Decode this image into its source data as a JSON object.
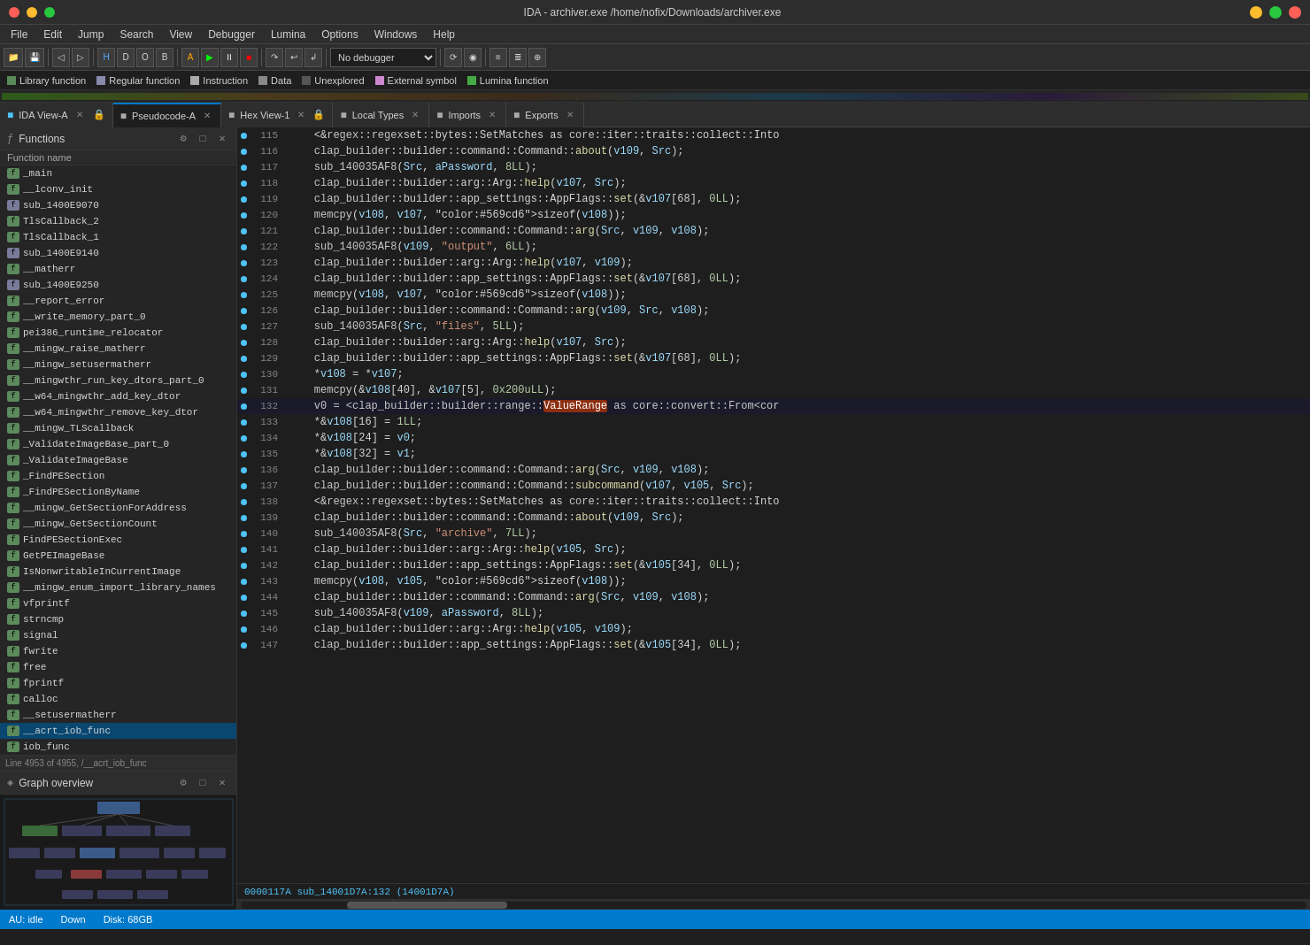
{
  "titlebar": {
    "title": "IDA - archiver.exe /home/nofix/Downloads/archiver.exe"
  },
  "menubar": {
    "items": [
      "File",
      "Edit",
      "Jump",
      "Search",
      "View",
      "Debugger",
      "Lumina",
      "Options",
      "Windows",
      "Help"
    ]
  },
  "tabs": [
    {
      "label": "IDA View-A",
      "active": false,
      "icon": "■"
    },
    {
      "label": "Pseudocode-A",
      "active": true,
      "icon": "■"
    },
    {
      "label": "Hex View-1",
      "active": false,
      "icon": "■"
    },
    {
      "label": "Local Types",
      "active": false,
      "icon": "■"
    },
    {
      "label": "Imports",
      "active": false,
      "icon": "■"
    },
    {
      "label": "Exports",
      "active": false,
      "icon": "■"
    }
  ],
  "sidebar": {
    "title": "Functions",
    "col_header": "Function name",
    "status": "Line 4953 of 4955, /__acrt_iob_func",
    "functions": [
      {
        "name": "_main",
        "type": "lib"
      },
      {
        "name": "__lconv_init",
        "type": "lib"
      },
      {
        "name": "sub_1400E9070",
        "type": "reg"
      },
      {
        "name": "TlsCallback_2",
        "type": "lib"
      },
      {
        "name": "TlsCallback_1",
        "type": "lib"
      },
      {
        "name": "sub_1400E9140",
        "type": "reg"
      },
      {
        "name": "__matherr",
        "type": "lib"
      },
      {
        "name": "sub_1400E9250",
        "type": "reg"
      },
      {
        "name": "__report_error",
        "type": "lib"
      },
      {
        "name": "__write_memory_part_0",
        "type": "lib"
      },
      {
        "name": "pei386_runtime_relocator",
        "type": "lib"
      },
      {
        "name": "__mingw_raise_matherr",
        "type": "lib"
      },
      {
        "name": "__mingw_setusermatherr",
        "type": "lib"
      },
      {
        "name": "__mingwthr_run_key_dtors_part_0",
        "type": "lib"
      },
      {
        "name": "__w64_mingwthr_add_key_dtor",
        "type": "lib"
      },
      {
        "name": "__w64_mingwthr_remove_key_dtor",
        "type": "lib"
      },
      {
        "name": "__mingw_TLScallback",
        "type": "lib"
      },
      {
        "name": "_ValidateImageBase_part_0",
        "type": "lib"
      },
      {
        "name": "_ValidateImageBase",
        "type": "lib"
      },
      {
        "name": "_FindPESection",
        "type": "lib"
      },
      {
        "name": "_FindPESectionByName",
        "type": "lib"
      },
      {
        "name": "__mingw_GetSectionForAddress",
        "type": "lib"
      },
      {
        "name": "__mingw_GetSectionCount",
        "type": "lib"
      },
      {
        "name": "FindPESectionExec",
        "type": "lib"
      },
      {
        "name": "GetPEImageBase",
        "type": "lib"
      },
      {
        "name": "IsNonwritableInCurrentImage",
        "type": "lib"
      },
      {
        "name": "__mingw_enum_import_library_names",
        "type": "lib"
      },
      {
        "name": "vfprintf",
        "type": "lib"
      },
      {
        "name": "strncmp",
        "type": "lib"
      },
      {
        "name": "signal",
        "type": "lib"
      },
      {
        "name": "fwrite",
        "type": "lib"
      },
      {
        "name": "free",
        "type": "lib"
      },
      {
        "name": "fprintf",
        "type": "lib"
      },
      {
        "name": "calloc",
        "type": "lib"
      },
      {
        "name": "__setusermatherr",
        "type": "lib"
      },
      {
        "name": "__acrt_iob_func",
        "type": "iob"
      },
      {
        "name": "iob_func",
        "type": "lib"
      }
    ]
  },
  "graph": {
    "title": "Graph overview"
  },
  "code": {
    "lines": [
      {
        "num": 115,
        "code": "    <&regex::regexset::bytes::SetMatches as core::iter::traits::collect::Into"
      },
      {
        "num": 116,
        "code": "    clap_builder::builder::command::Command::about(v109, Src);"
      },
      {
        "num": 117,
        "code": "    sub_140035AF8(Src, aPassword, 8LL);"
      },
      {
        "num": 118,
        "code": "    clap_builder::builder::arg::Arg::help(v107, Src);"
      },
      {
        "num": 119,
        "code": "    clap_builder::builder::app_settings::AppFlags::set(&v107[68], 0LL);"
      },
      {
        "num": 120,
        "code": "    memcpy(v108, v107, sizeof(v108));"
      },
      {
        "num": 121,
        "code": "    clap_builder::builder::command::Command::arg(Src, v109, v108);"
      },
      {
        "num": 122,
        "code": "    sub_140035AF8(v109, \"output\", 6LL);"
      },
      {
        "num": 123,
        "code": "    clap_builder::builder::arg::Arg::help(v107, v109);"
      },
      {
        "num": 124,
        "code": "    clap_builder::builder::app_settings::AppFlags::set(&v107[68], 0LL);"
      },
      {
        "num": 125,
        "code": "    memcpy(v108, v107, sizeof(v108));"
      },
      {
        "num": 126,
        "code": "    clap_builder::builder::command::Command::arg(v109, Src, v108);"
      },
      {
        "num": 127,
        "code": "    sub_140035AF8(Src, \"files\", 5LL);"
      },
      {
        "num": 128,
        "code": "    clap_builder::builder::arg::Arg::help(v107, Src);"
      },
      {
        "num": 129,
        "code": "    clap_builder::builder::app_settings::AppFlags::set(&v107[68], 0LL);"
      },
      {
        "num": 130,
        "code": "    *v108 = *v107;"
      },
      {
        "num": 131,
        "code": "    memcpy(&v108[40], &v107[5], 0x200uLL);"
      },
      {
        "num": 132,
        "code": "    v0 = <clap_builder::builder::range::ValueRange as core::convert::From<cor"
      },
      {
        "num": 133,
        "code": "    *&v108[16] = 1LL;"
      },
      {
        "num": 134,
        "code": "    *&v108[24] = v0;"
      },
      {
        "num": 135,
        "code": "    *&v108[32] = v1;"
      },
      {
        "num": 136,
        "code": "    clap_builder::builder::command::Command::arg(Src, v109, v108);"
      },
      {
        "num": 137,
        "code": "    clap_builder::builder::command::Command::subcommand(v107, v105, Src);"
      },
      {
        "num": 138,
        "code": "    <&regex::regexset::bytes::SetMatches as core::iter::traits::collect::Into"
      },
      {
        "num": 139,
        "code": "    clap_builder::builder::command::Command::about(v109, Src);"
      },
      {
        "num": 140,
        "code": "    sub_140035AF8(Src, \"archive\", 7LL);"
      },
      {
        "num": 141,
        "code": "    clap_builder::builder::arg::Arg::help(v105, Src);"
      },
      {
        "num": 142,
        "code": "    clap_builder::builder::app_settings::AppFlags::set(&v105[34], 0LL);"
      },
      {
        "num": 143,
        "code": "    memcpy(v108, v105, sizeof(v108));"
      },
      {
        "num": 144,
        "code": "    clap_builder::builder::command::Command::arg(Src, v109, v108);"
      },
      {
        "num": 145,
        "code": "    sub_140035AF8(v109, aPassword, 8LL);"
      },
      {
        "num": 146,
        "code": "    clap_builder::builder::arg::Arg::help(v105, v109);"
      },
      {
        "num": 147,
        "code": "    clap_builder::builder::app_settings::AppFlags::set(&v105[34], 0LL);"
      }
    ],
    "highlighted_line": 132,
    "highlighted_word": "ValueRange"
  },
  "statusbar": {
    "address": "0000117A sub_14001D7A:132 (14001D7A)",
    "au_status": "AU: idle",
    "direction": "Down",
    "disk": "Disk: 68GB"
  },
  "legend": [
    {
      "label": "Library function",
      "color": "#5a8a5a"
    },
    {
      "label": "Regular function",
      "color": "#8a8aaa"
    },
    {
      "label": "Instruction",
      "color": "#aaaaaa"
    },
    {
      "label": "Data",
      "color": "#888888"
    },
    {
      "label": "Unexplored",
      "color": "#555555"
    },
    {
      "label": "External symbol",
      "color": "#cc88cc"
    },
    {
      "label": "Lumina function",
      "color": "#44aa44"
    }
  ]
}
